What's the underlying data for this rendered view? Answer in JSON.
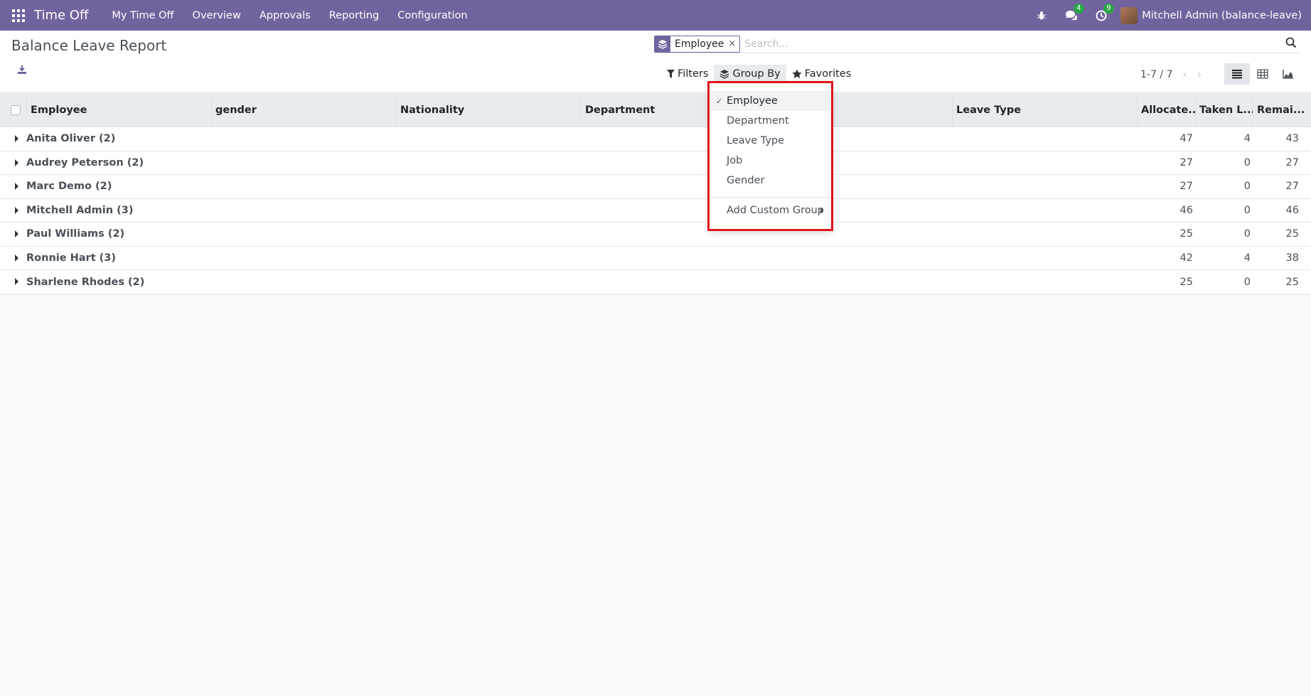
{
  "navbar": {
    "app_name": "Time Off",
    "menu": [
      "My Time Off",
      "Overview",
      "Approvals",
      "Reporting",
      "Configuration"
    ],
    "messages_badge": "4",
    "activities_badge": "9",
    "user": "Mitchell Admin (balance-leave)"
  },
  "control": {
    "title": "Balance Leave Report",
    "facet_value": "Employee",
    "facet_remove": "×",
    "search_placeholder": "Search...",
    "filters_label": "Filters",
    "groupby_label": "Group By",
    "favorites_label": "Favorites",
    "pager": "1-7 / 7"
  },
  "table": {
    "columns": [
      "Employee",
      "gender",
      "Nationality",
      "Department",
      "Leave Type",
      "Allocate...",
      "Taken L...",
      "Remai..."
    ],
    "rows": [
      {
        "name": "Anita Oliver (2)",
        "allocated": "47",
        "taken": "4",
        "remaining": "43"
      },
      {
        "name": "Audrey Peterson (2)",
        "allocated": "27",
        "taken": "0",
        "remaining": "27"
      },
      {
        "name": "Marc Demo (2)",
        "allocated": "27",
        "taken": "0",
        "remaining": "27"
      },
      {
        "name": "Mitchell Admin (3)",
        "allocated": "46",
        "taken": "0",
        "remaining": "46"
      },
      {
        "name": "Paul Williams (2)",
        "allocated": "25",
        "taken": "0",
        "remaining": "25"
      },
      {
        "name": "Ronnie Hart (3)",
        "allocated": "42",
        "taken": "4",
        "remaining": "38"
      },
      {
        "name": "Sharlene Rhodes (2)",
        "allocated": "25",
        "taken": "0",
        "remaining": "25"
      }
    ]
  },
  "groupby_menu": {
    "items": [
      "Employee",
      "Department",
      "Leave Type",
      "Job",
      "Gender"
    ],
    "selected_check": "✓",
    "custom_group": "Add Custom Group"
  },
  "colors": {
    "navbar": "#71639e",
    "highlight": "#e0151b",
    "badge": "#28a745"
  }
}
